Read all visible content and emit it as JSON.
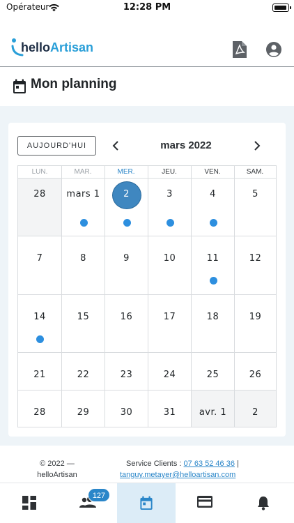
{
  "status_bar": {
    "carrier": "Opérateur",
    "time": "12:28 PM"
  },
  "header": {
    "logo_part1": "hello",
    "logo_part2": "Artisan",
    "icons": [
      "pdf-icon",
      "account-circle-icon"
    ]
  },
  "page": {
    "title": "Mon planning",
    "title_icon": "calendar-icon"
  },
  "calendar": {
    "today_button": "AUJOURD'HUI",
    "month": "mars 2022",
    "weekdays": [
      "LUN.",
      "MAR.",
      "MER.",
      "JEU.",
      "VEN.",
      "SAM."
    ],
    "weeks": [
      [
        {
          "label": "28",
          "shaded": true,
          "event": false
        },
        {
          "label": "mars 1",
          "event": true
        },
        {
          "label": "2",
          "today": true,
          "event": true
        },
        {
          "label": "3",
          "event": true
        },
        {
          "label": "4",
          "event": true
        },
        {
          "label": "5",
          "event": false
        }
      ],
      [
        {
          "label": "7"
        },
        {
          "label": "8"
        },
        {
          "label": "9"
        },
        {
          "label": "10"
        },
        {
          "label": "11",
          "event": true
        },
        {
          "label": "12"
        }
      ],
      [
        {
          "label": "14",
          "event": true
        },
        {
          "label": "15"
        },
        {
          "label": "16"
        },
        {
          "label": "17"
        },
        {
          "label": "18"
        },
        {
          "label": "19"
        }
      ],
      [
        {
          "label": "21"
        },
        {
          "label": "22"
        },
        {
          "label": "23"
        },
        {
          "label": "24"
        },
        {
          "label": "25"
        },
        {
          "label": "26"
        }
      ],
      [
        {
          "label": "28"
        },
        {
          "label": "29"
        },
        {
          "label": "30"
        },
        {
          "label": "31"
        },
        {
          "label": "avr. 1",
          "shaded": true
        },
        {
          "label": "2",
          "shaded": true
        }
      ]
    ]
  },
  "footer": {
    "copyright_line1": "© 2022 —",
    "copyright_line2": "helloArtisan",
    "service_label": "Service Clients :",
    "phone": "07 63 52 46 36",
    "separator": "|",
    "email": "tanguy.metayer@helloartisan.com"
  },
  "bottom_nav": {
    "items": [
      "dashboard-icon",
      "clients-icon",
      "calendar-icon",
      "payment-card-icon",
      "notifications-icon"
    ],
    "active": "calendar-icon",
    "clients_badge": "127"
  },
  "colors": {
    "accent": "#2a86c9",
    "event_dot": "#2d8fdf",
    "today_circle": "#3f87c0",
    "main_background": "#eef4f8",
    "active_nav": "#dcecf7"
  }
}
